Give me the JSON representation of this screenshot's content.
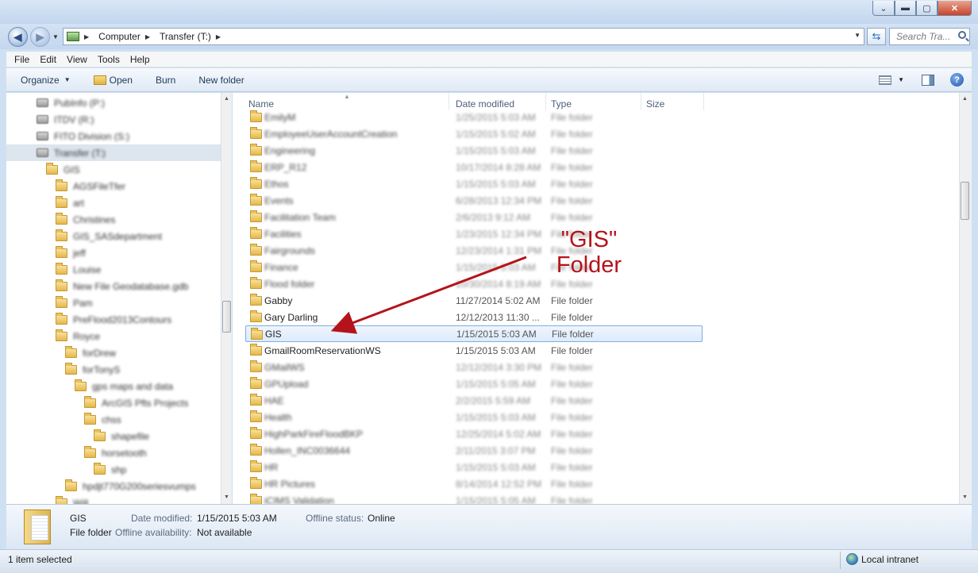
{
  "window": {
    "controls": {
      "minimize": "▬",
      "maximize": "▢",
      "close": "✕",
      "restore_down": "⌄"
    }
  },
  "navigation": {
    "back_icon": "arrow-left",
    "forward_icon": "arrow-right",
    "breadcrumb": [
      "Computer",
      "Transfer (T:)"
    ],
    "search_placeholder": "Search Tra...",
    "refresh_icon": "⇆"
  },
  "menu": [
    "File",
    "Edit",
    "View",
    "Tools",
    "Help"
  ],
  "toolbar": {
    "organize": "Organize",
    "open": "Open",
    "burn": "Burn",
    "new_folder": "New folder"
  },
  "columns": {
    "name": "Name",
    "date": "Date modified",
    "type": "Type",
    "size": "Size"
  },
  "nav_tree": [
    {
      "label": "PubInfo (P:)",
      "indent": 0,
      "icon": "network-drive"
    },
    {
      "label": "ITDV (R:)",
      "indent": 0,
      "icon": "network-drive"
    },
    {
      "label": "FITO Division (S:)",
      "indent": 0,
      "icon": "network-drive"
    },
    {
      "label": "Transfer (T:)",
      "indent": 0,
      "icon": "network-drive",
      "selected": true
    },
    {
      "label": "GIS",
      "indent": 1,
      "icon": "folder"
    },
    {
      "label": "AGSFileTfer",
      "indent": 2,
      "icon": "folder"
    },
    {
      "label": "art",
      "indent": 2,
      "icon": "folder"
    },
    {
      "label": "Christines",
      "indent": 2,
      "icon": "folder"
    },
    {
      "label": "GIS_SASdepartment",
      "indent": 2,
      "icon": "folder"
    },
    {
      "label": "jeff",
      "indent": 2,
      "icon": "folder"
    },
    {
      "label": "Louise",
      "indent": 2,
      "icon": "folder"
    },
    {
      "label": "New File Geodatabase.gdb",
      "indent": 2,
      "icon": "folder"
    },
    {
      "label": "Pam",
      "indent": 2,
      "icon": "folder"
    },
    {
      "label": "PreFlood2013Contours",
      "indent": 2,
      "icon": "folder"
    },
    {
      "label": "Royce",
      "indent": 2,
      "icon": "folder"
    },
    {
      "label": "forDrew",
      "indent": 3,
      "icon": "folder"
    },
    {
      "label": "forTonyS",
      "indent": 3,
      "icon": "folder"
    },
    {
      "label": "gps maps and data",
      "indent": 4,
      "icon": "folder"
    },
    {
      "label": "ArcGIS Pfts Projects",
      "indent": 5,
      "icon": "folder"
    },
    {
      "label": "chss",
      "indent": 5,
      "icon": "folder"
    },
    {
      "label": "shapefile",
      "indent": 6,
      "icon": "folder"
    },
    {
      "label": "horsetooth",
      "indent": 5,
      "icon": "folder"
    },
    {
      "label": "shp",
      "indent": 6,
      "icon": "folder"
    },
    {
      "label": "hpdjt770G200seriesvumps",
      "indent": 3,
      "icon": "folder"
    },
    {
      "label": "Will",
      "indent": 2,
      "icon": "folder"
    }
  ],
  "files": [
    {
      "name": "EmilyM",
      "date": "1/25/2015 5:03 AM",
      "type": "File folder",
      "blur": true
    },
    {
      "name": "EmployeeUserAccountCreation",
      "date": "1/15/2015 5:02 AM",
      "type": "File folder",
      "blur": true
    },
    {
      "name": "Engineering",
      "date": "1/15/2015 5:03 AM",
      "type": "File folder",
      "blur": true
    },
    {
      "name": "ERP_R12",
      "date": "10/17/2014 8:28 AM",
      "type": "File folder",
      "blur": true
    },
    {
      "name": "Ethos",
      "date": "1/15/2015 5:03 AM",
      "type": "File folder",
      "blur": true
    },
    {
      "name": "Events",
      "date": "6/28/2013 12:34 PM",
      "type": "File folder",
      "blur": true
    },
    {
      "name": "Facilitation Team",
      "date": "2/6/2013 9:12 AM",
      "type": "File folder",
      "blur": true
    },
    {
      "name": "Facilities",
      "date": "1/23/2015 12:34 PM",
      "type": "File folder",
      "blur": true
    },
    {
      "name": "Fairgrounds",
      "date": "12/23/2014 1:31 PM",
      "type": "File folder",
      "blur": true
    },
    {
      "name": "Finance",
      "date": "1/15/2015 5:03 AM",
      "type": "File folder",
      "blur": true
    },
    {
      "name": "Flood folder",
      "date": "10/30/2014 8:19 AM",
      "type": "File folder",
      "blur": true
    },
    {
      "name": "Gabby",
      "date": "11/27/2014 5:02 AM",
      "type": "File folder",
      "blur": false
    },
    {
      "name": "Gary Darling",
      "date": "12/12/2013 11:30 ...",
      "type": "File folder",
      "blur": false
    },
    {
      "name": "GIS",
      "date": "1/15/2015 5:03 AM",
      "type": "File folder",
      "blur": false,
      "selected": true
    },
    {
      "name": "GmailRoomReservationWS",
      "date": "1/15/2015 5:03 AM",
      "type": "File folder",
      "blur": false
    },
    {
      "name": "GMailWS",
      "date": "12/12/2014 3:30 PM",
      "type": "File folder",
      "blur": true
    },
    {
      "name": "GPUpload",
      "date": "1/15/2015 5:05 AM",
      "type": "File folder",
      "blur": true
    },
    {
      "name": "HAE",
      "date": "2/2/2015 5:59 AM",
      "type": "File folder",
      "blur": true
    },
    {
      "name": "Health",
      "date": "1/15/2015 5:03 AM",
      "type": "File folder",
      "blur": true
    },
    {
      "name": "HighParkFireFloodBKP",
      "date": "12/25/2014 5:02 AM",
      "type": "File folder",
      "blur": true
    },
    {
      "name": "Hollen_INC0036644",
      "date": "2/11/2015 3:07 PM",
      "type": "File folder",
      "blur": true
    },
    {
      "name": "HR",
      "date": "1/15/2015 5:03 AM",
      "type": "File folder",
      "blur": true
    },
    {
      "name": "HR Pictures",
      "date": "8/14/2014 12:52 PM",
      "type": "File folder",
      "blur": true
    },
    {
      "name": "iCIMS Validation",
      "date": "1/15/2015 5:05 AM",
      "type": "File folder",
      "blur": true
    }
  ],
  "annotation": {
    "line1": "\"GIS\"",
    "line2": "Folder",
    "color": "#b5131b"
  },
  "details": {
    "name": "GIS",
    "kind": "File folder",
    "date_label": "Date modified:",
    "date_value": "1/15/2015 5:03 AM",
    "offline_status_label": "Offline status:",
    "offline_status_value": "Online",
    "offline_avail_label": "Offline availability:",
    "offline_avail_value": "Not available"
  },
  "status": {
    "selection": "1 item selected",
    "zone": "Local intranet"
  }
}
